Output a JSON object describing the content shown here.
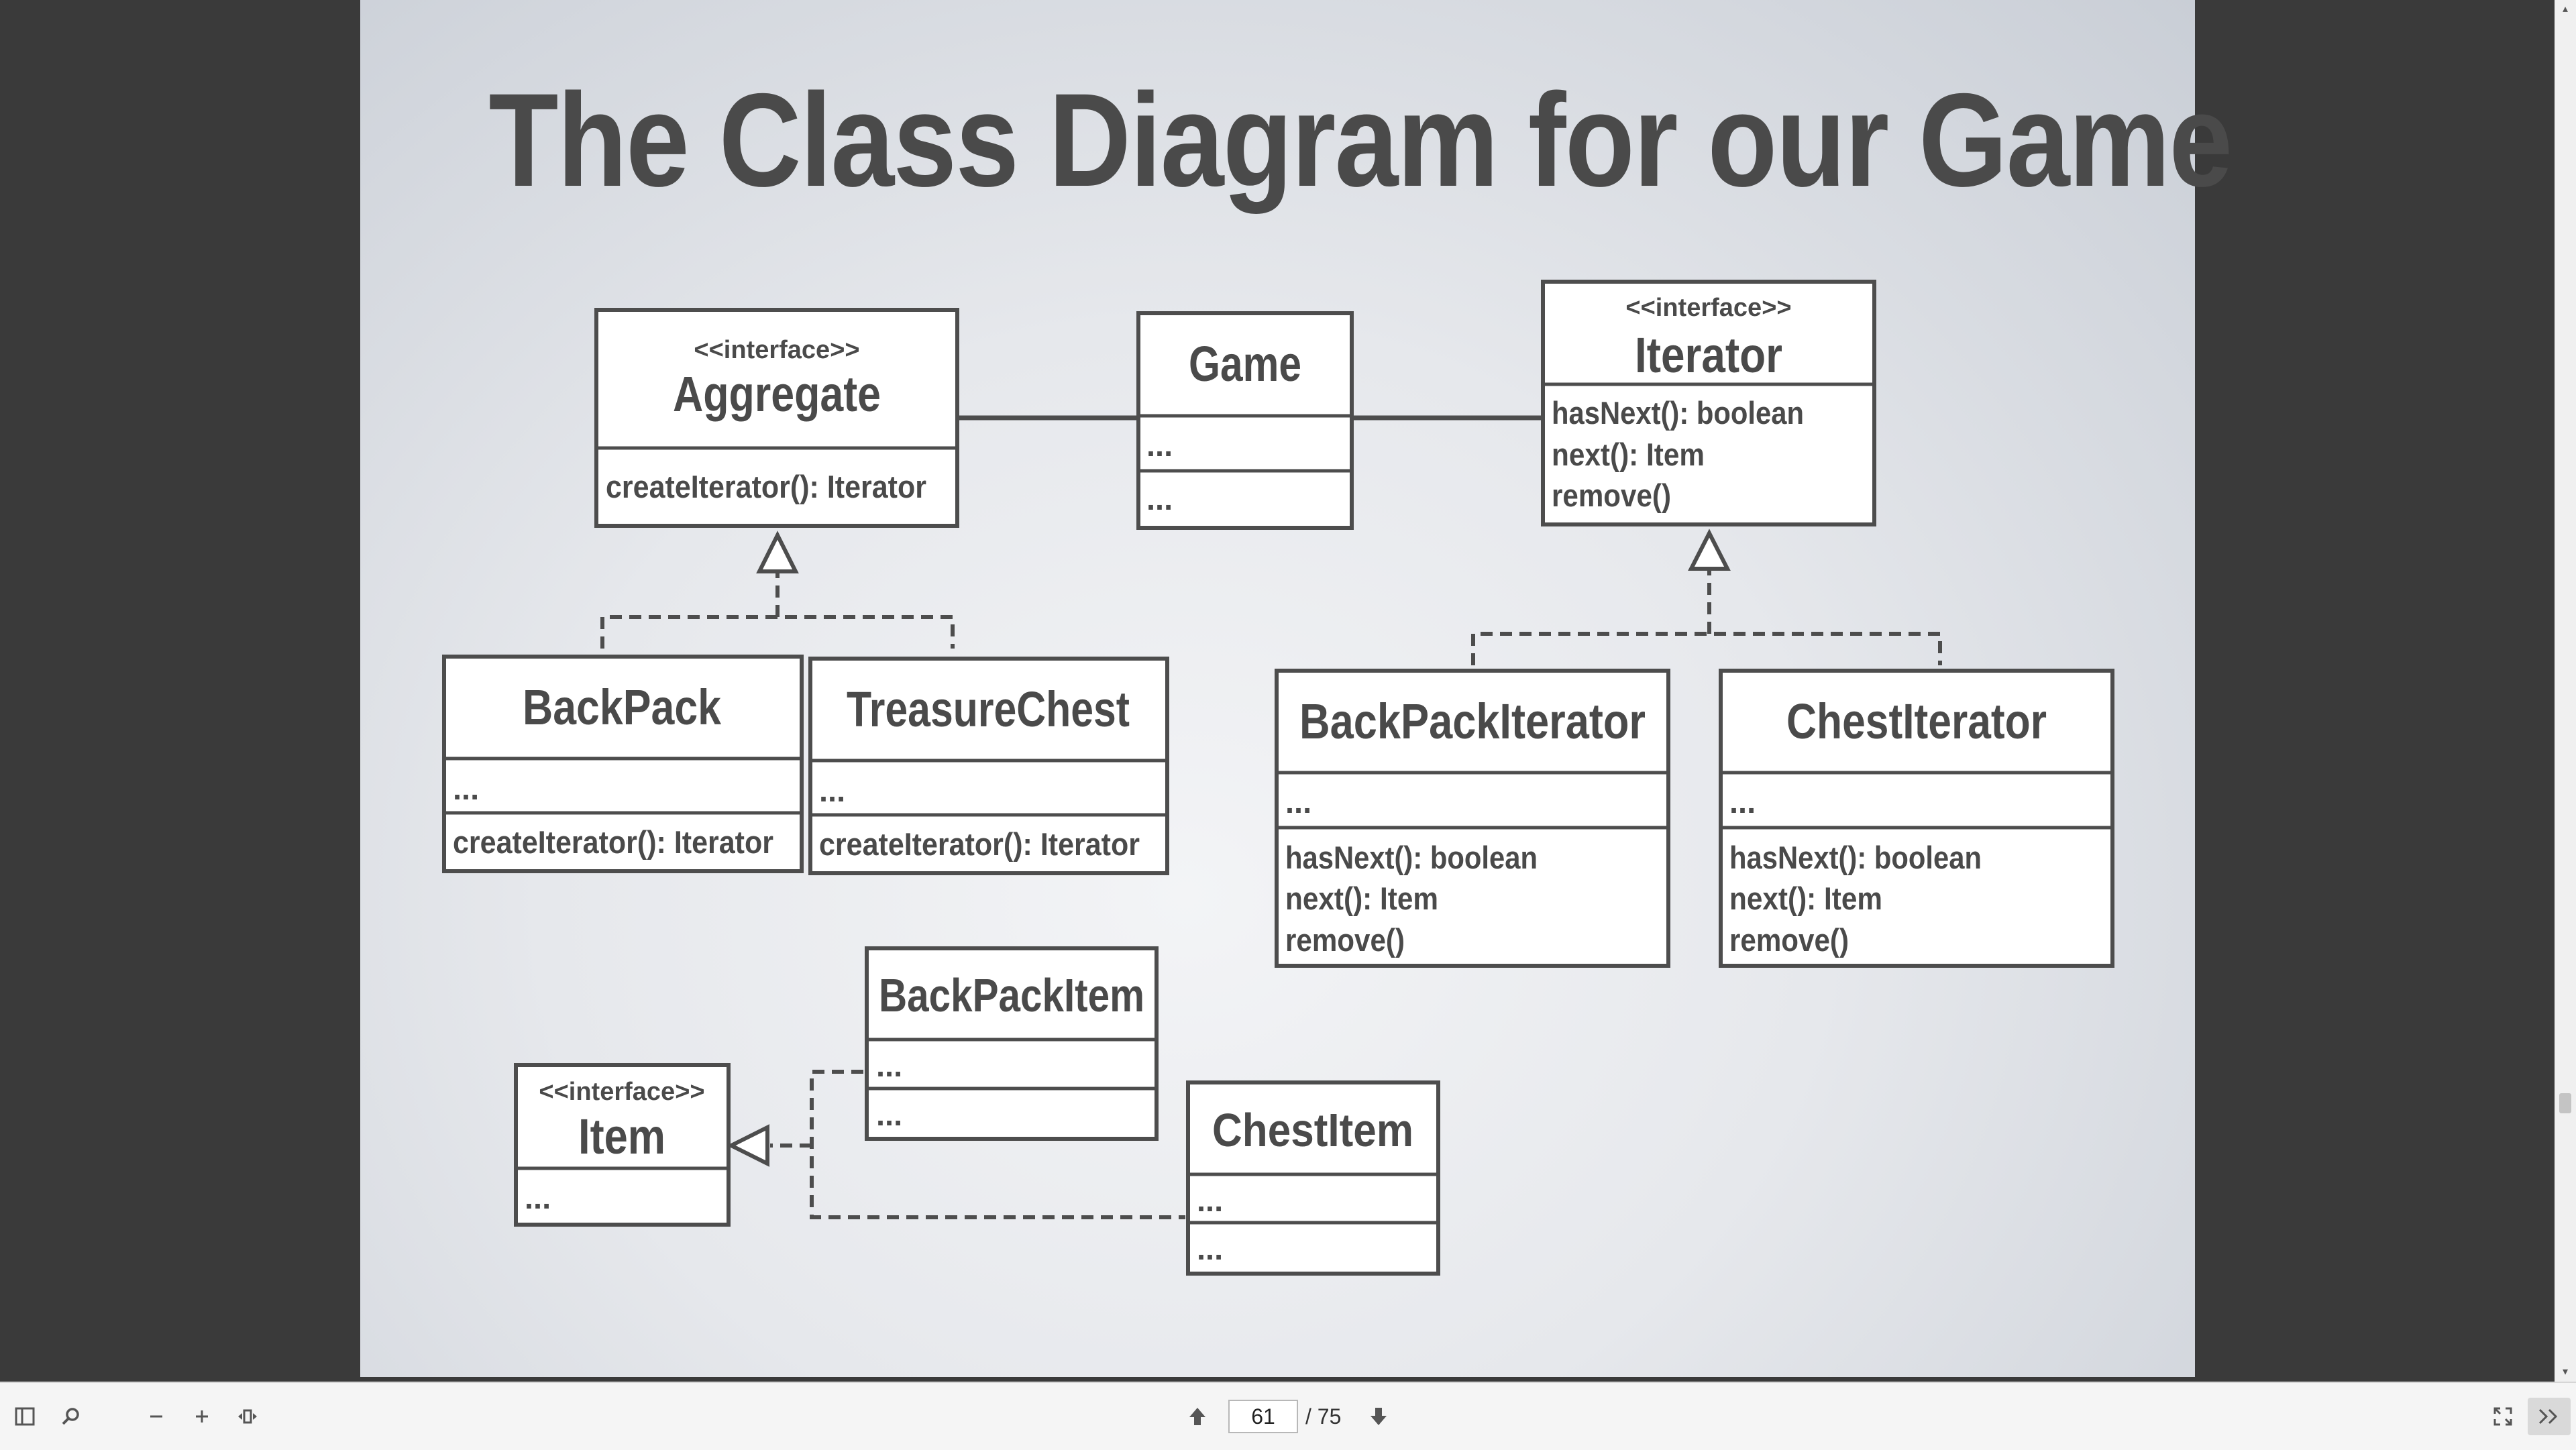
{
  "slide": {
    "title": "The Class Diagram for our Game"
  },
  "diagram": {
    "stereotype": "<<interface>>",
    "classes": {
      "aggregate": {
        "name": "Aggregate",
        "methods": [
          "createIterator(): Iterator"
        ]
      },
      "game": {
        "name": "Game",
        "attributes": "...",
        "methods": "..."
      },
      "iterator": {
        "name": "Iterator",
        "methods": [
          "hasNext(): boolean",
          "next(): Item",
          "remove()"
        ]
      },
      "backpack": {
        "name": "BackPack",
        "attributes": "...",
        "methods": [
          "createIterator(): Iterator"
        ]
      },
      "treasurechest": {
        "name": "TreasureChest",
        "attributes": "...",
        "methods": [
          "createIterator(): Iterator"
        ]
      },
      "backpackiterator": {
        "name": "BackPackIterator",
        "attributes": "...",
        "methods": [
          "hasNext(): boolean",
          "next(): Item",
          "remove()"
        ]
      },
      "chestiterator": {
        "name": "ChestIterator",
        "attributes": "...",
        "methods": [
          "hasNext(): boolean",
          "next(): Item",
          "remove()"
        ]
      },
      "backpackitem": {
        "name": "BackPackItem",
        "attributes": "...",
        "methods": "..."
      },
      "item": {
        "name": "Item",
        "attributes": "..."
      },
      "chestitem": {
        "name": "ChestItem",
        "attributes": "...",
        "methods": "..."
      }
    }
  },
  "toolbar": {
    "page_number": "61",
    "page_total": "/ 75",
    "icons": [
      "sidebar-toggle-icon",
      "search-icon",
      "zoom-out-icon",
      "zoom-in-icon",
      "fit-page-icon",
      "previous-page-icon",
      "next-page-icon",
      "fullscreen-icon",
      "expand-icon"
    ]
  }
}
